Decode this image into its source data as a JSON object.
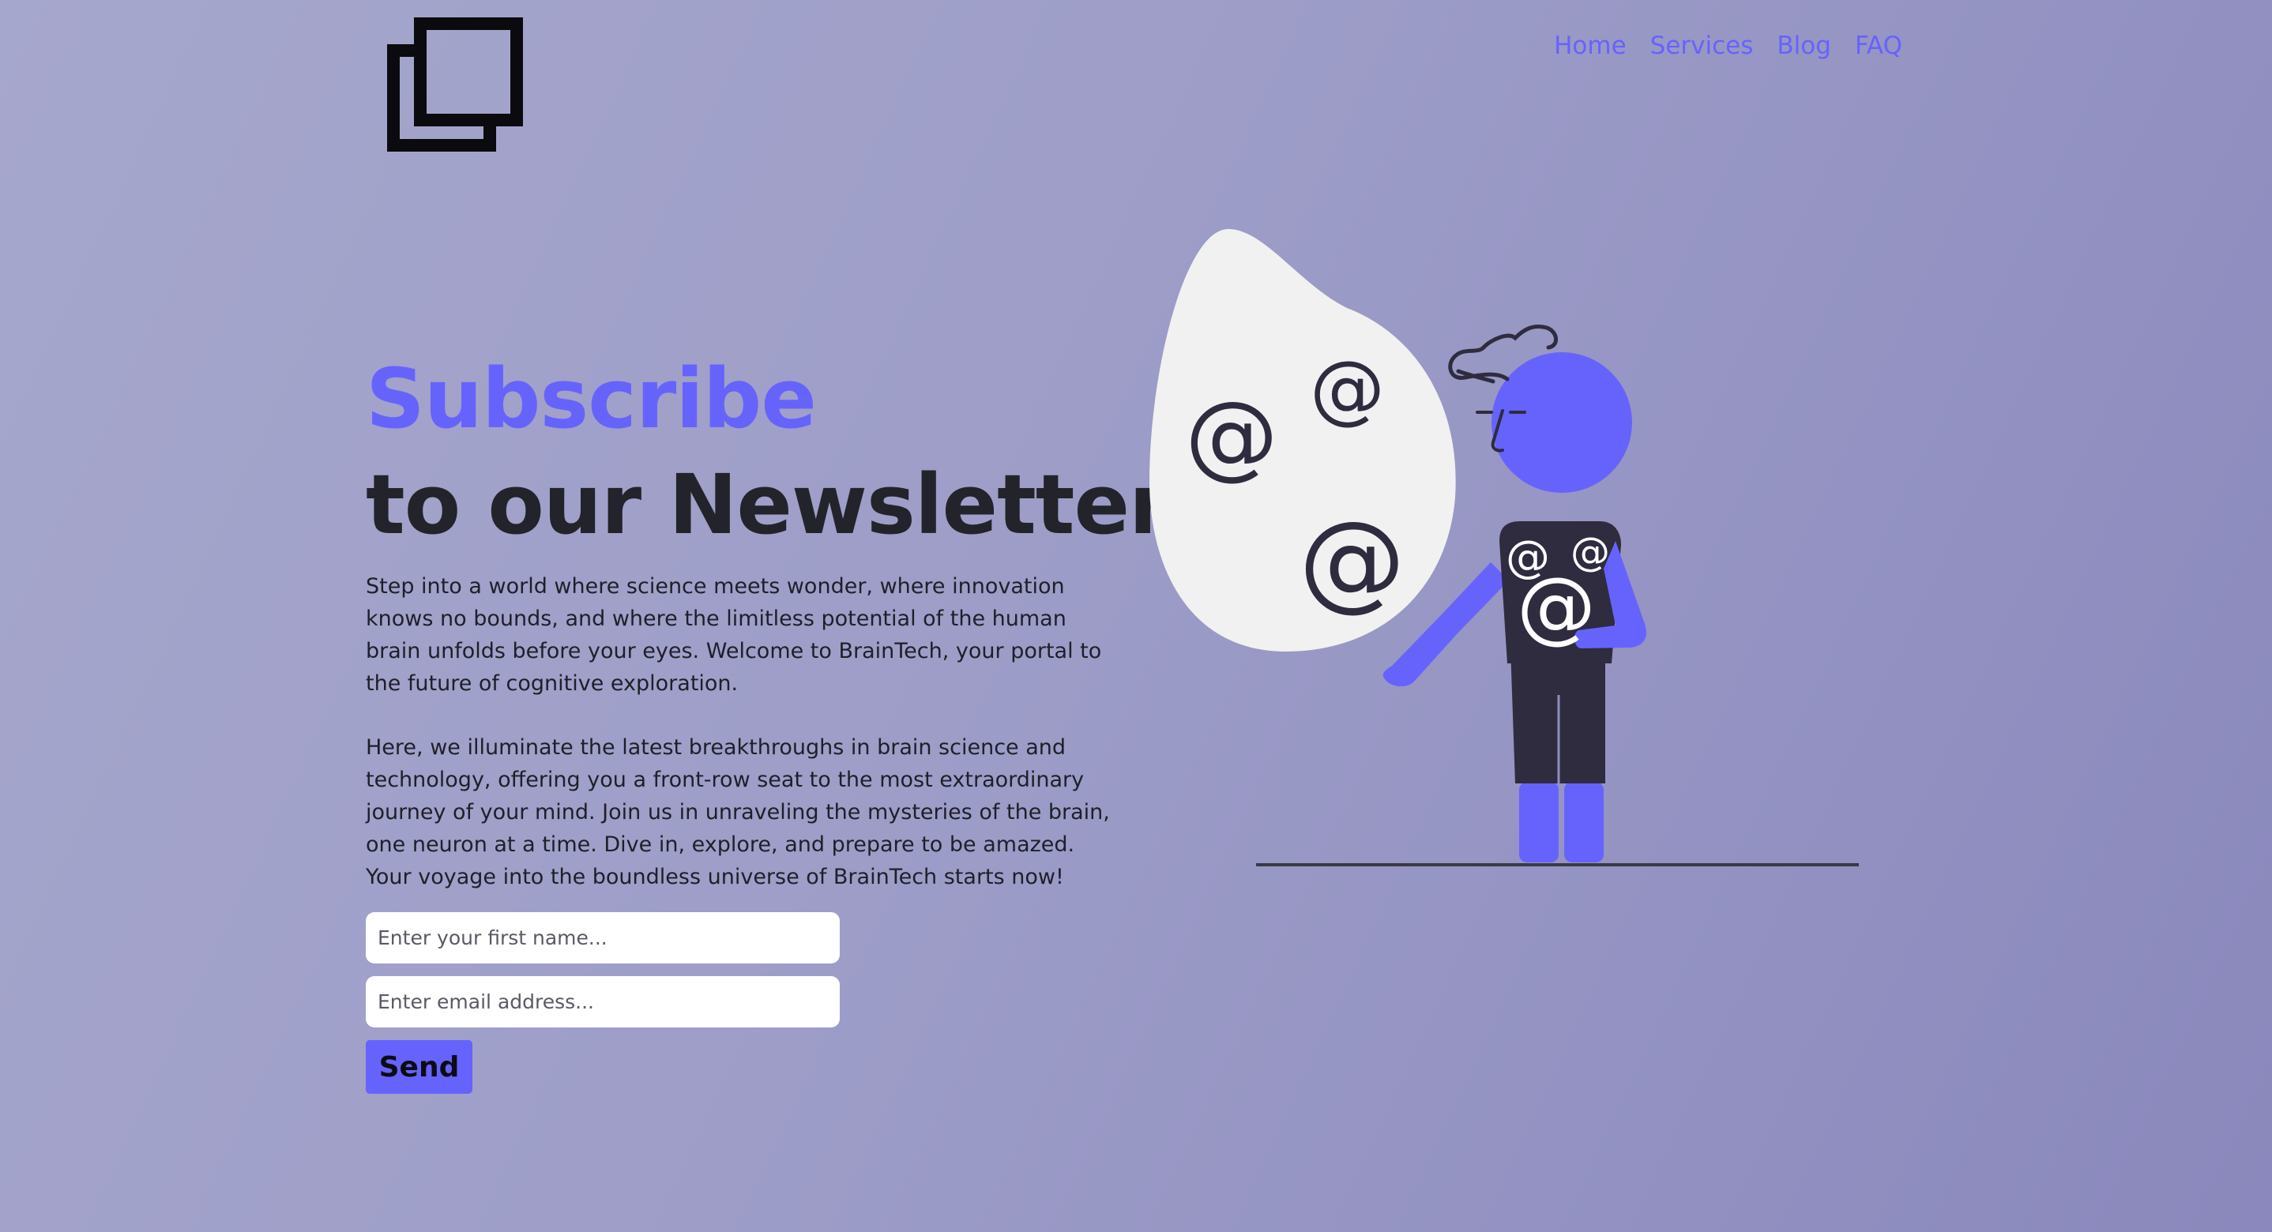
{
  "nav": {
    "items": [
      {
        "label": "Home"
      },
      {
        "label": "Services"
      },
      {
        "label": "Blog"
      },
      {
        "label": "FAQ"
      }
    ]
  },
  "hero": {
    "title_accent": "Subscribe",
    "title_main": "to our Newsletter",
    "paragraph_1": "Step into a world where science meets wonder, where innovation knows no bounds, and where the limitless potential of the human brain unfolds before your eyes. Welcome to BrainTech, your portal to the future of cognitive exploration.",
    "paragraph_2": "Here, we illuminate the latest breakthroughs in brain science and technology, offering you a front-row seat to the most extraordinary journey of your mind. Join us in unraveling the mysteries of the brain, one neuron at a time. Dive in, explore, and prepare to be amazed. Your voyage into the boundless universe of BrainTech starts now!"
  },
  "form": {
    "first_name_placeholder": "Enter your first name...",
    "email_placeholder": "Enter email address...",
    "send_label": "Send"
  },
  "colors": {
    "accent": "#6663fc",
    "dark": "#23232b",
    "background_start": "#a6a7cc",
    "background_end": "#8a88bc"
  }
}
